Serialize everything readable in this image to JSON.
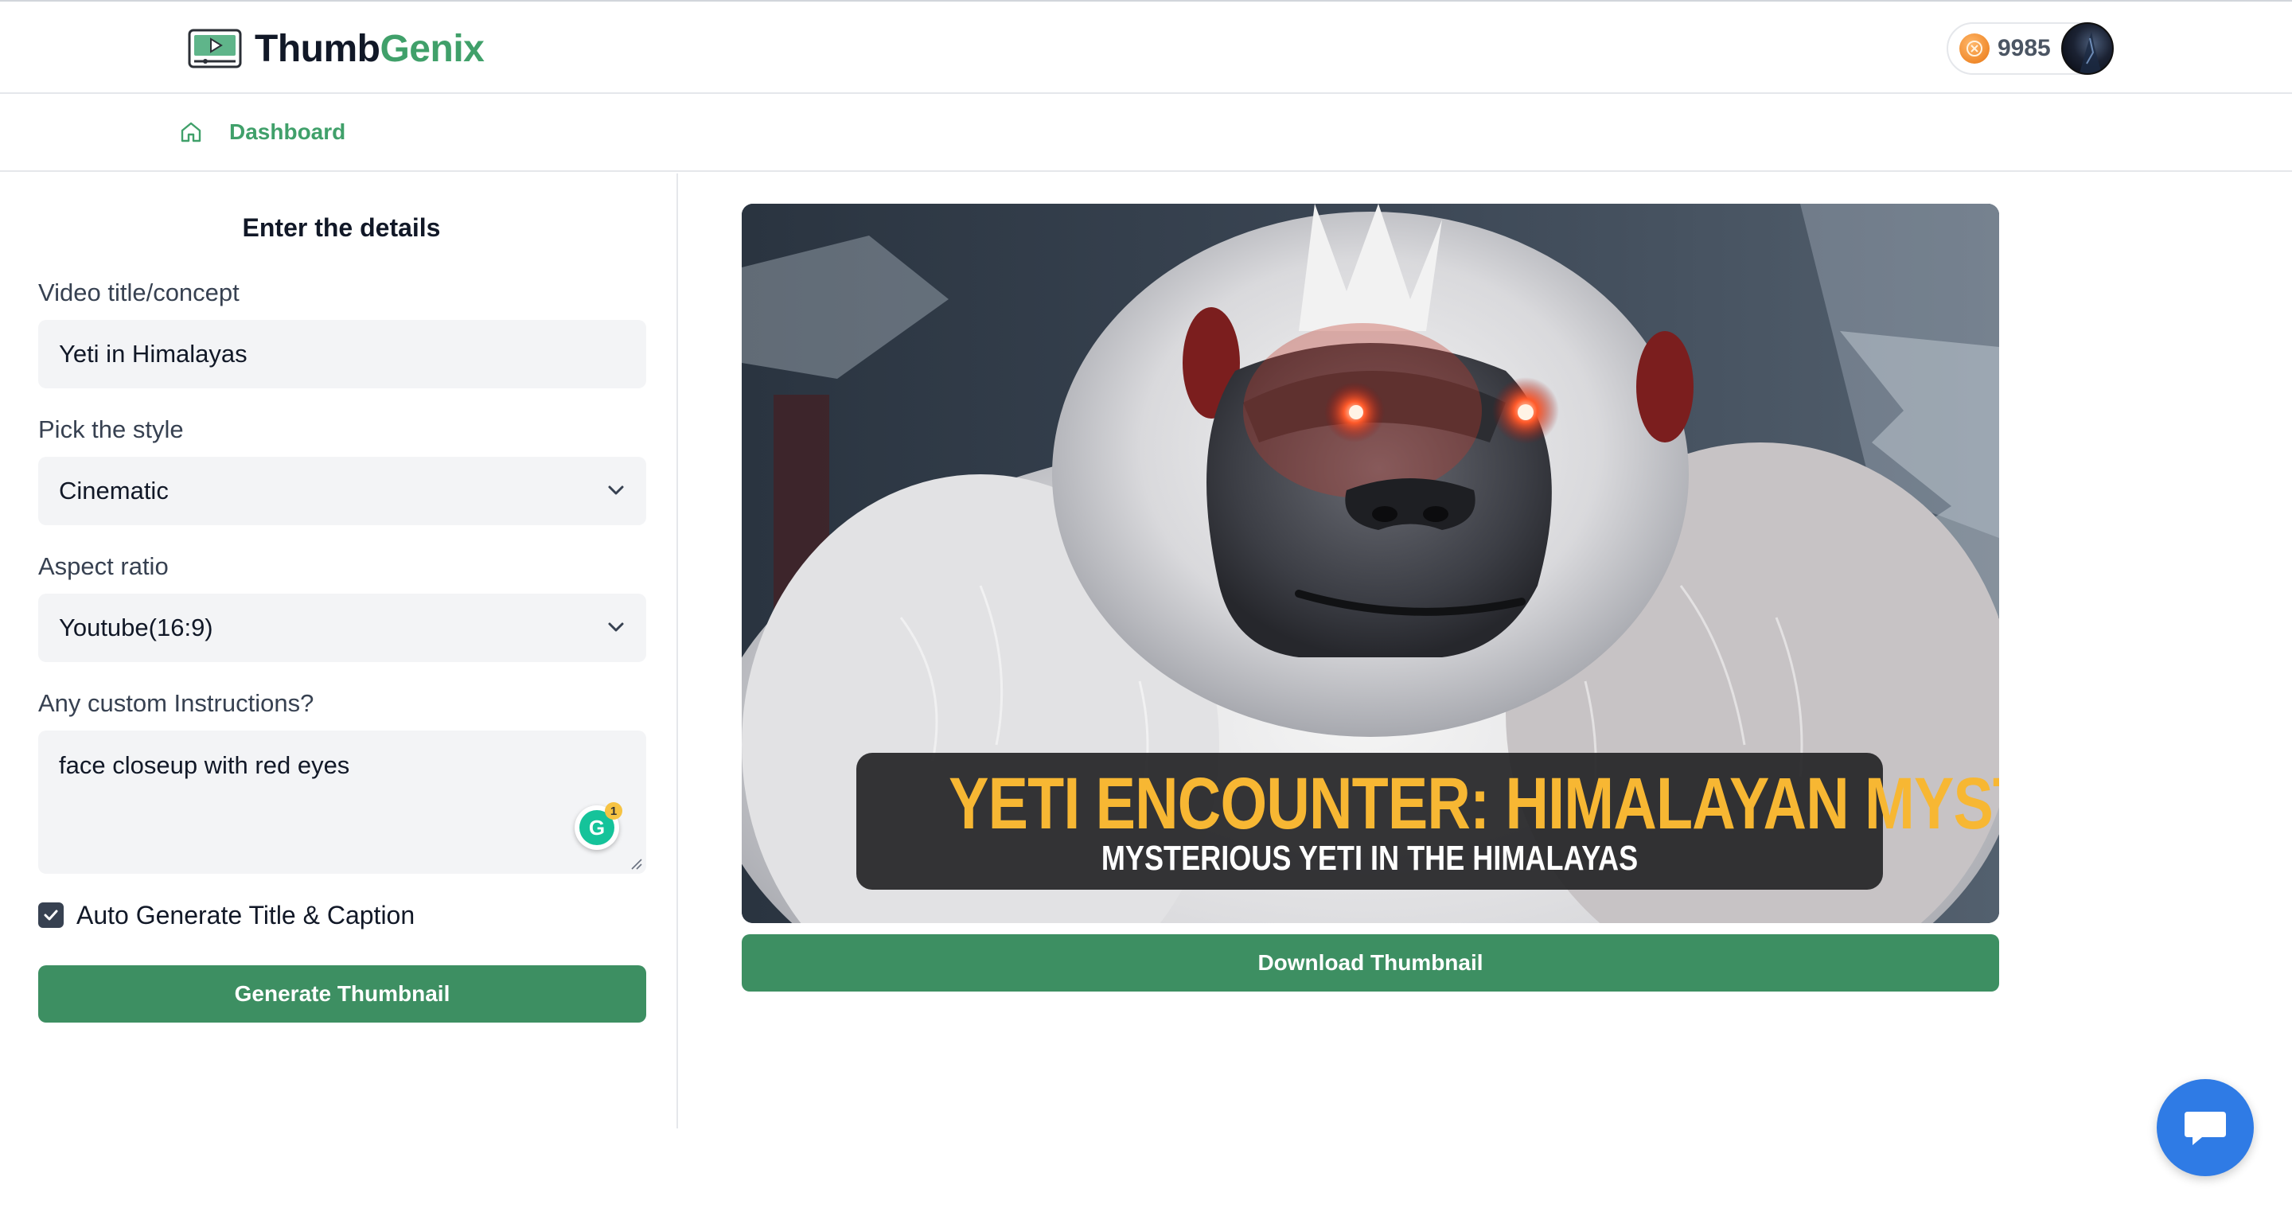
{
  "app": {
    "logo_part1": "Thumb",
    "logo_part2": "Genix",
    "credits": "9985"
  },
  "breadcrumb": {
    "label": "Dashboard"
  },
  "form": {
    "title": "Enter the details",
    "video_title_label": "Video title/concept",
    "video_title_value": "Yeti in Himalayas",
    "style_label": "Pick the style",
    "style_value": "Cinematic",
    "aspect_label": "Aspect ratio",
    "aspect_value": "Youtube(16:9)",
    "instructions_label": "Any custom Instructions?",
    "instructions_value": "face closeup with red eyes",
    "grammarly_count": "1",
    "auto_generate_label": "Auto Generate Title & Caption",
    "auto_generate_checked": true,
    "generate_button": "Generate Thumbnail"
  },
  "thumbnail": {
    "caption_title": "YETI ENCOUNTER: HIMALAYAN MYSTERY",
    "caption_subtitle": "MYSTERIOUS YETI IN THE HIMALAYAS",
    "download_button": "Download Thumbnail"
  },
  "icons": {
    "logo": "video-player-icon",
    "coin": "coin-icon",
    "home": "home-icon",
    "dropdown": "chevron-down-icon",
    "check": "check-icon",
    "chat": "chat-bubble-icon"
  },
  "colors": {
    "brand_green": "#40a06a",
    "button_green": "#3d8f62",
    "chat_blue": "#2f7be5",
    "caption_yellow": "#f7b733"
  }
}
